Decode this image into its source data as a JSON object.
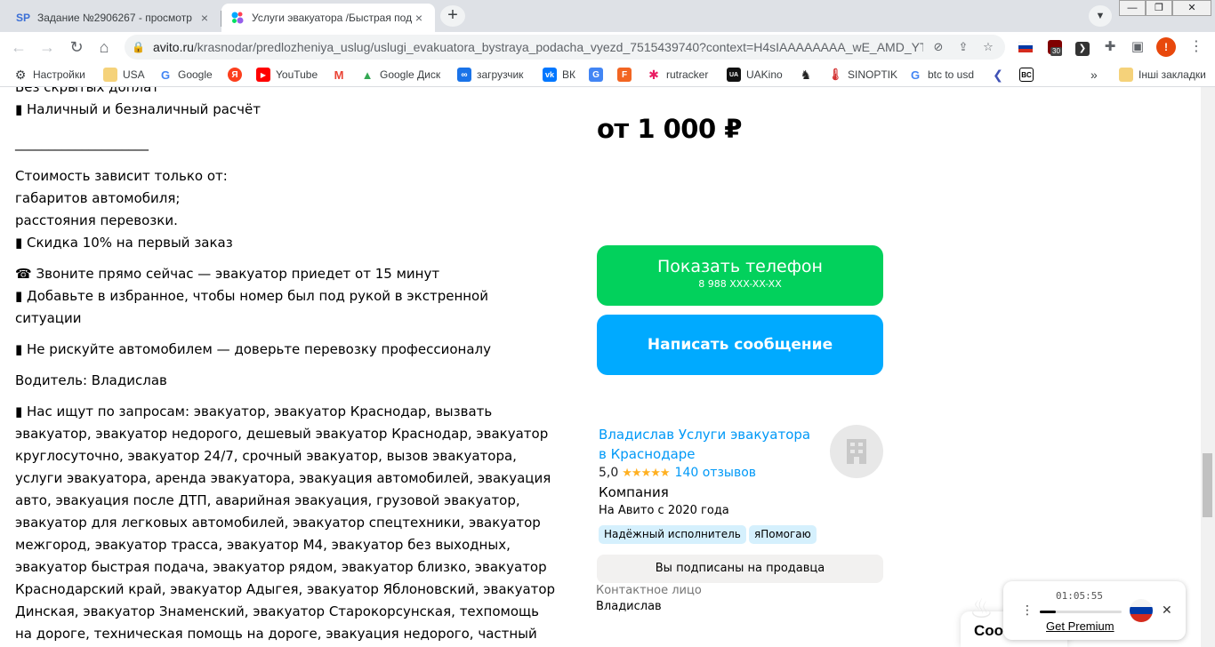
{
  "browser": {
    "tabs": [
      {
        "title": "Задание №2906267 - просмотр",
        "favicon_text": "SP",
        "active": false
      },
      {
        "title": "Услуги эвакуатора /Быстрая под",
        "favicon_text": "",
        "active": true
      }
    ],
    "new_tab_glyph": "+",
    "close_glyph": "×",
    "url_host": "avito.ru",
    "url_path": "/krasnodar/predlozheniya_uslug/uslugi_evakuatora_bystraya_podacha_vyezd_7515439740?context=H4sIAAAAAAAA_wE_AMD_YT...",
    "extension_badge": "30",
    "profile_initial": "!"
  },
  "bookmarks": [
    {
      "label": "Настройки",
      "icon": "gear-icon"
    },
    {
      "label": "USA",
      "icon": "folder-icon"
    },
    {
      "label": "Google",
      "icon": "google-icon"
    },
    {
      "label": "",
      "icon": "yandex-icon"
    },
    {
      "label": "YouTube",
      "icon": "youtube-icon"
    },
    {
      "label": "",
      "icon": "gmail-icon"
    },
    {
      "label": "Google Диск",
      "icon": "google-drive-icon"
    },
    {
      "label": "загрузчик",
      "icon": "infinity-icon"
    },
    {
      "label": "ВК",
      "icon": "vk-icon"
    },
    {
      "label": "",
      "icon": "translate-icon"
    },
    {
      "label": "",
      "icon": "f-icon"
    },
    {
      "label": "rutracker",
      "icon": "rutracker-icon"
    },
    {
      "label": "UAKino",
      "icon": "uakino-icon"
    },
    {
      "label": "",
      "icon": "chess-icon"
    },
    {
      "label": "SINOPTIK",
      "icon": "thermometer-icon"
    },
    {
      "label": "btc to usd",
      "icon": "google-icon"
    },
    {
      "label": "",
      "icon": "arrow-icon"
    },
    {
      "label": "",
      "icon": "bc-icon"
    }
  ],
  "bookmarks_overflow": "»",
  "other_bookmarks": "Інші закладки",
  "description": {
    "lines": [
      "Без скрытых доплат",
      "▮ Наличный и безналичный расчёт",
      "",
      "____________________",
      "",
      "Стоимость зависит только от:",
      "габаритов автомобиля;",
      "расстояния перевозки.",
      "▮ Скидка 10% на первый заказ",
      "",
      "☎ Звоните прямо сейчас — эвакуатор приедет от 15 минут",
      "▮ Добавьте в избранное, чтобы номер был под рукой в экстренной ситуации",
      "",
      "▮ Не рискуйте автомобилем — доверьте перевозку профессионалу",
      "",
      "Водитель: Владислав",
      "",
      "▮ Нас ищут по запросам: эвакуатор, эвакуатор Краснодар, вызвать эвакуатор, эвакуатор недорого, дешевый эвакуатор Краснодар, эвакуатор круглосуточно, эвакуатор 24/7, срочный эвакуатор, вызов эвакуатора, услуги эвакуатора, аренда эвакуатора, эвакуация автомобилей, эвакуация авто, эвакуация после ДТП, аварийная эвакуация, грузовой эвакуатор, эвакуатор для легковых автомобилей, эвакуатор спецтехники, эвакуатор межгород, эвакуатор трасса, эвакуатор М4, эвакуатор без выходных, эвакуатор быстрая подача, эвакуатор рядом, эвакуатор близко, эвакуатор Краснодарский край, эвакуатор Адыгея, эвакуатор Яблоновский, эвакуатор Динская, эвакуатор Знаменский, эвакуатор Старокорсунская, техпомощь на дороге, техническая помощь на дороге, эвакуация недорого, частный эвакуатор, эвакуатор срочно, номер эвакуатора, телефон эвакуатора."
    ]
  },
  "listing": {
    "price": "от 1 000 ₽",
    "show_phone_label": "Показать телефон",
    "phone_masked": "8 988 XXX-XX-XX",
    "message_label": "Написать сообщение"
  },
  "seller": {
    "name": "Владислав Услуги эвакуатора в Краснодаре",
    "rating": "5,0",
    "stars": "★★★★★",
    "reviews": "140 отзывов",
    "type": "Компания",
    "since": "На Авито с 2020 года",
    "badges": [
      "Надёжный исполнитель",
      "яПомогаю"
    ],
    "subscribed_label": "Вы подписаны на продавца",
    "contact_label": "Контактное лицо",
    "contact_name": "Владислав"
  },
  "chat_widget": {
    "label": "Соо"
  },
  "player_widget": {
    "time": "01:05:55",
    "progress": 0.2,
    "premium_label": "Get Premium"
  },
  "colors": {
    "phone_button": "#02d15c",
    "message_button": "#00aaff",
    "link": "#0099f7",
    "star": "#ffb021",
    "badge_bg": "#d5f0fd"
  }
}
